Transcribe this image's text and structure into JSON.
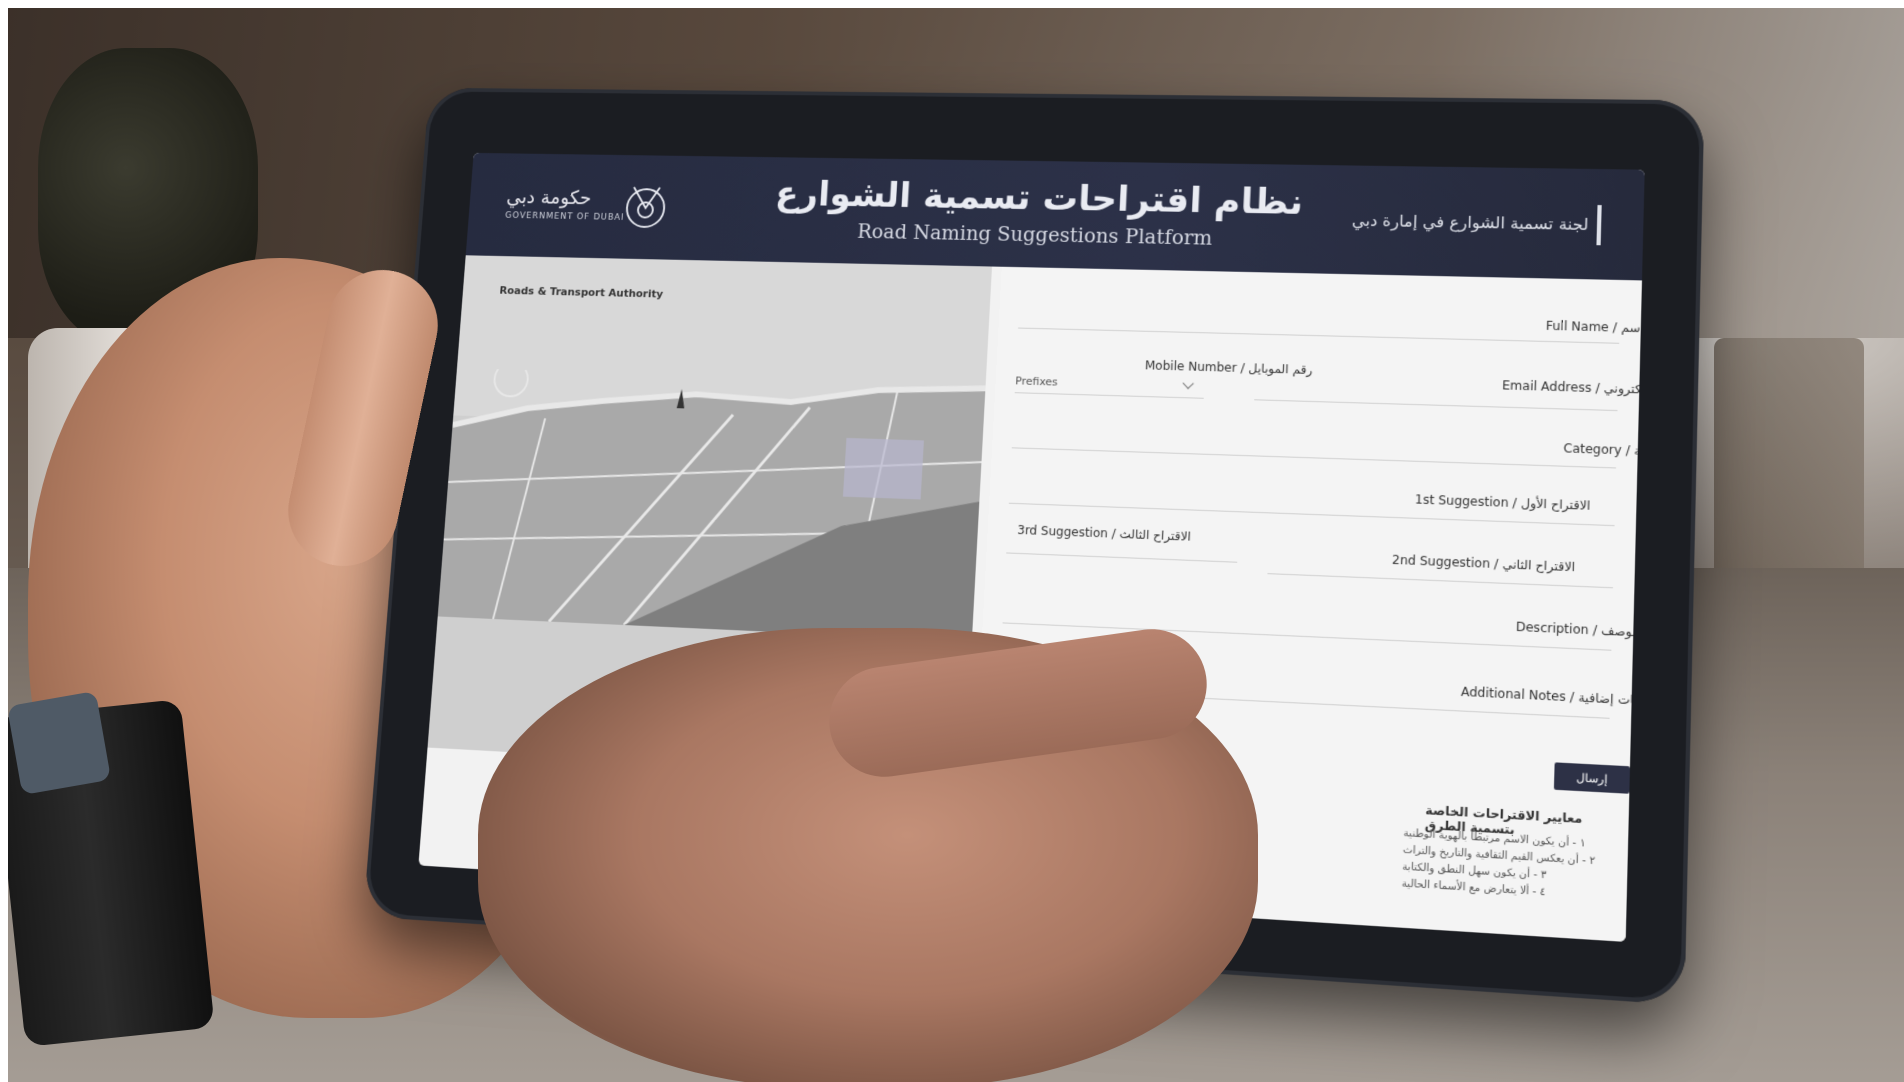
{
  "header": {
    "gov_logo_ar": "حكومة دبي",
    "gov_logo_en": "GOVERNMENT OF DUBAI",
    "title_ar": "نظام اقتراحات تسمية الشوارع",
    "title_en": "Road Naming Suggestions Platform",
    "right_logo": "لجنة تسمية الشوارع في إمارة دبي"
  },
  "map": {
    "rta_logo": "Roads & Transport Authority"
  },
  "form": {
    "full_name": "Full Name / الاسم",
    "mobile_number": "Mobile Number / رقم الموبايل",
    "email_address": "Email Address / البريد الإلكتروني",
    "mobile_prefix": "Prefixes",
    "category": "Category / الفئة",
    "first_suggestion": "1st Suggestion / الاقتراح الأول",
    "second_suggestion": "2nd Suggestion / الاقتراح الثاني",
    "third_suggestion": "3rd Suggestion / الاقتراح الثالث",
    "description": "Description / الوصف",
    "additional_notes": "Additional Notes / ملاحظات إضافية",
    "submit": "إرسال",
    "rules_title": "معايير الاقتراحات الخاصة بتسمية الطرق",
    "rules": [
      "١ - أن يكون الاسم مرتبطاً بالهوية الوطنية",
      "٢ - أن يعكس القيم الثقافية والتاريخ والتراث",
      "٣ - أن يكون سهل النطق والكتابة",
      "٤ - ألا يتعارض مع الأسماء الحالية"
    ]
  },
  "colors": {
    "header_bg": "#2a2f45",
    "button_bg": "#2d3146",
    "form_bg": "#f4f4f4",
    "map_gray": "#9a9a9a"
  }
}
